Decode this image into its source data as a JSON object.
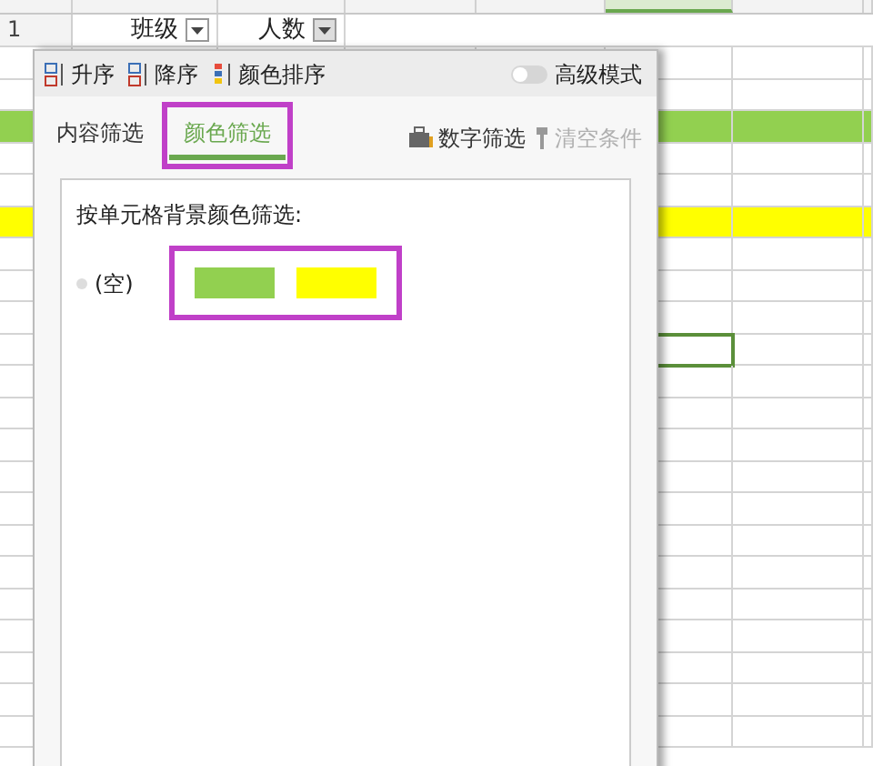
{
  "sheet": {
    "header_row": {
      "row_number": "1",
      "cells": [
        {
          "text": "班级",
          "filter": true
        },
        {
          "text": "人数",
          "filter": true
        }
      ]
    },
    "rows": [
      {
        "selected": false
      },
      {
        "selected": false
      },
      {
        "selected": false,
        "color": "#92d050"
      },
      {
        "selected": false
      },
      {
        "selected": false
      },
      {
        "selected": false,
        "color": "#ffff00"
      },
      {
        "selected": false
      },
      {
        "selected": false
      },
      {
        "selected": false
      },
      {
        "selected": true
      },
      {
        "selected": false
      },
      {
        "selected": false
      },
      {
        "selected": false
      },
      {
        "selected": false
      },
      {
        "selected": false
      },
      {
        "selected": false
      },
      {
        "selected": false
      },
      {
        "selected": false
      },
      {
        "selected": false
      },
      {
        "selected": false
      },
      {
        "selected": false
      },
      {
        "selected": false
      }
    ]
  },
  "filter_panel": {
    "sort_buttons": [
      {
        "kind": "asc",
        "label": "升序"
      },
      {
        "kind": "desc",
        "label": "降序"
      },
      {
        "kind": "color",
        "label": "颜色排序"
      }
    ],
    "advanced_mode": {
      "label": "高级模式",
      "on": false
    },
    "tabs": [
      {
        "label": "内容筛选",
        "selected": false,
        "highlighted": false
      },
      {
        "label": "颜色筛选",
        "selected": true,
        "highlighted": true
      }
    ],
    "actions": [
      {
        "kind": "number",
        "label": "数字筛选",
        "disabled": false
      },
      {
        "kind": "clear",
        "label": "清空条件",
        "disabled": true
      }
    ],
    "color_filter": {
      "heading": "按单元格背景颜色筛选:",
      "empty_option": {
        "label": "(空)",
        "selected": false
      },
      "swatches_highlighted": true,
      "swatches": [
        {
          "color": "#92d050",
          "selected": false
        },
        {
          "color": "#ffff00",
          "selected": false
        }
      ]
    }
  }
}
